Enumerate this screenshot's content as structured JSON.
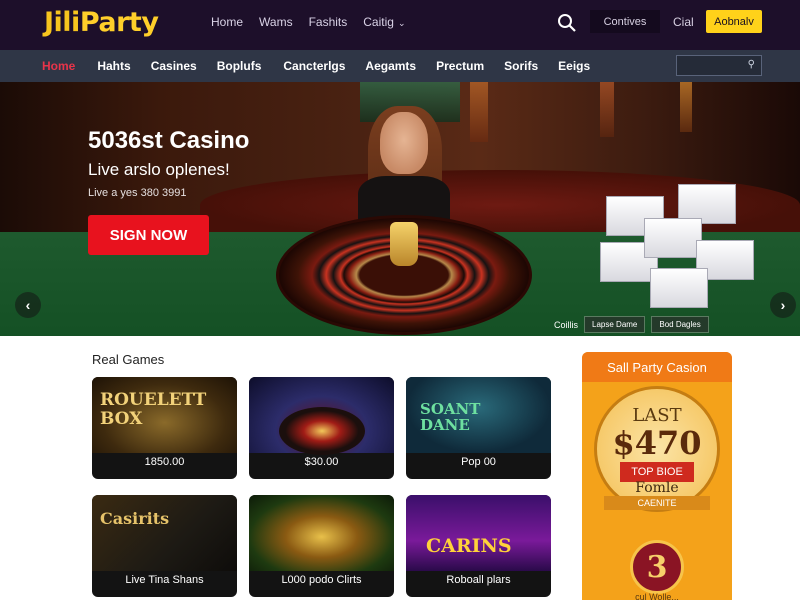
{
  "brand": {
    "left": "Jili",
    "right": "Party"
  },
  "topnav": {
    "items": [
      "Home",
      "Wams",
      "Fashits",
      "Caitig"
    ]
  },
  "topbar": {
    "field_text": "Contives",
    "link": "Cial",
    "button": "Aobnalv"
  },
  "subnav": {
    "items": [
      "Home",
      "Hahts",
      "Casines",
      "Boplufs",
      "Cancterlgs",
      "Aegamts",
      "Prectum",
      "Sorifs",
      "Eeigs"
    ],
    "active_index": 0
  },
  "hero": {
    "title": "5036st Casino",
    "subtitle": "Live arslo oplenes!",
    "small": "Live a yes 380 3991",
    "cta": "SIGN NOW",
    "tag_label": "Coillis",
    "tags": [
      "Lapse Dame",
      "Bod Dagles"
    ],
    "prev_icon": "chevron-left-icon",
    "next_icon": "chevron-right-icon"
  },
  "section": {
    "title": "Real Games"
  },
  "games": [
    {
      "art_text": "ROUELETT BOX",
      "caption": "1850.00"
    },
    {
      "art_text": "",
      "caption": "$30.00"
    },
    {
      "art_text": "SOANT DANE",
      "caption": "Pop 00"
    },
    {
      "art_text": "Casirits",
      "caption": "Live Tina Shans"
    },
    {
      "art_text": "",
      "caption": "L000 podo Clirts"
    },
    {
      "art_text": "CARINS",
      "caption": "Roboall plars"
    }
  ],
  "promo": {
    "title": "Sall Party Casion",
    "last": "LAST",
    "amount": "$470",
    "ribbon": "TOP BIOE",
    "fomle": "Fomle",
    "banner": "CAENITE",
    "coin": "3",
    "footer": "cul Wolle..."
  },
  "colors": {
    "topbar": "#1d0f2a",
    "subnav": "#2f3646",
    "accent": "#ffd21a",
    "cta": "#e8121e",
    "promo": "#f4a21a"
  }
}
